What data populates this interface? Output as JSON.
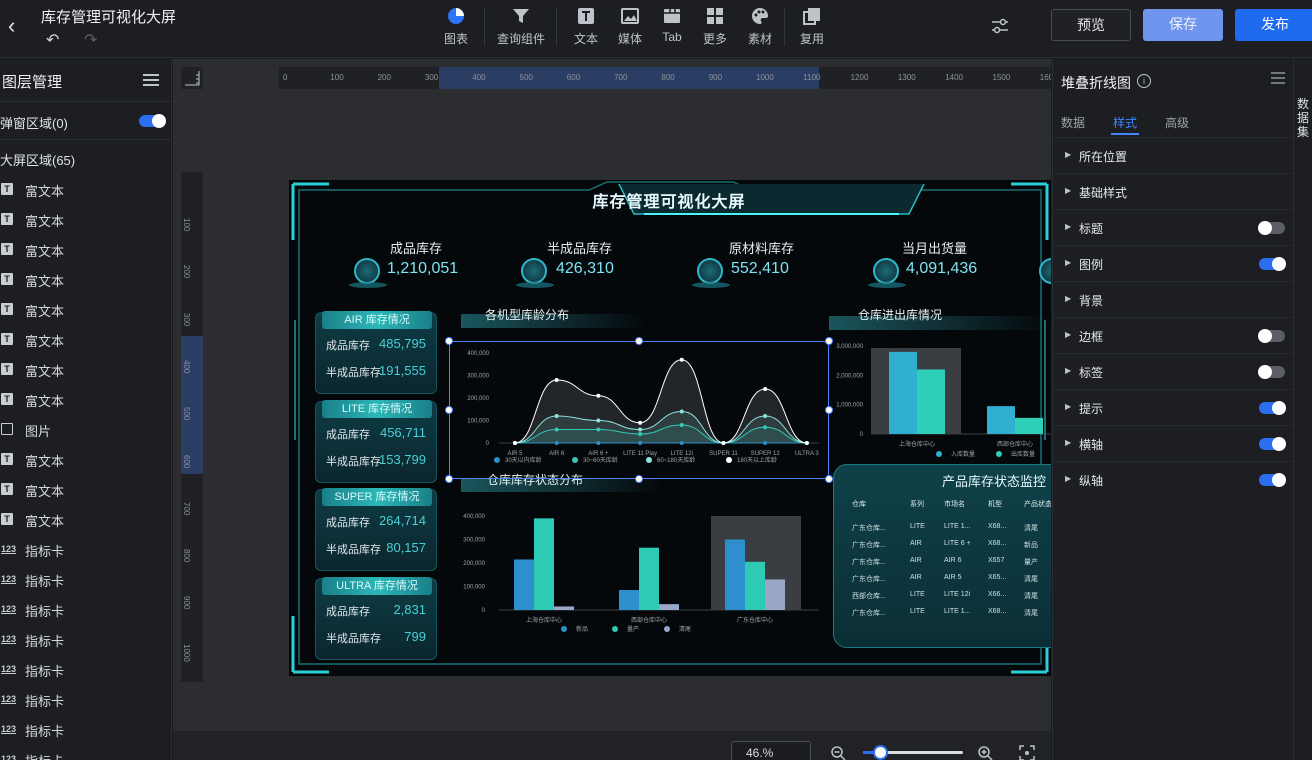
{
  "header": {
    "title": "库存管理可视化大屏",
    "toolbar": [
      {
        "label": "图表",
        "icon": "pie-chart-icon"
      },
      {
        "label": "查询组件",
        "icon": "filter-icon"
      },
      {
        "label": "文本",
        "icon": "text-icon"
      },
      {
        "label": "媒体",
        "icon": "image-icon"
      },
      {
        "label": "Tab",
        "icon": "tab-icon"
      },
      {
        "label": "更多",
        "icon": "grid-icon"
      },
      {
        "label": "素材",
        "icon": "palette-icon"
      },
      {
        "label": "复用",
        "icon": "copy-icon"
      }
    ],
    "preview_label": "预览",
    "save_label": "保存",
    "publish_label": "发布"
  },
  "layers": {
    "title": "图层管理",
    "popup_area": "弹窗区域(0)",
    "popup_toggle": true,
    "screen_area": "大屏区域(65)",
    "items": [
      {
        "type": "T",
        "name": "富文本"
      },
      {
        "type": "T",
        "name": "富文本"
      },
      {
        "type": "T",
        "name": "富文本"
      },
      {
        "type": "T",
        "name": "富文本"
      },
      {
        "type": "T",
        "name": "富文本"
      },
      {
        "type": "T",
        "name": "富文本"
      },
      {
        "type": "T",
        "name": "富文本"
      },
      {
        "type": "T",
        "name": "富文本"
      },
      {
        "type": "img",
        "name": "图片"
      },
      {
        "type": "T",
        "name": "富文本"
      },
      {
        "type": "T",
        "name": "富文本"
      },
      {
        "type": "T",
        "name": "富文本"
      },
      {
        "type": "123",
        "name": "指标卡"
      },
      {
        "type": "123",
        "name": "指标卡"
      },
      {
        "type": "123",
        "name": "指标卡"
      },
      {
        "type": "123",
        "name": "指标卡"
      },
      {
        "type": "123",
        "name": "指标卡"
      },
      {
        "type": "123",
        "name": "指标卡"
      },
      {
        "type": "123",
        "name": "指标卡"
      },
      {
        "type": "123",
        "name": "指标卡"
      }
    ]
  },
  "ruler": {
    "top": [
      "0",
      "100",
      "200",
      "300",
      "400",
      "500",
      "600",
      "700",
      "800",
      "900",
      "1000",
      "1100",
      "1200",
      "1300",
      "1400",
      "1500",
      "1600"
    ],
    "left": [
      "100",
      "200",
      "300",
      "400",
      "500",
      "600",
      "700",
      "800",
      "900",
      "1000"
    ]
  },
  "zoom": "46.%",
  "dashboard": {
    "title": "库存管理可视化大屏",
    "kpis": [
      {
        "label": "成品库存",
        "value": "1,210,051"
      },
      {
        "label": "半成品库存",
        "value": "426,310"
      },
      {
        "label": "原材料库存",
        "value": "552,410"
      },
      {
        "label": "当月出货量",
        "value": "4,091,436"
      }
    ],
    "cards": [
      {
        "title": "AIR 库存情况",
        "rows": [
          {
            "label": "成品库存",
            "value": "485,795"
          },
          {
            "label": "半成品库存",
            "value": "191,555"
          }
        ]
      },
      {
        "title": "LITE 库存情况",
        "rows": [
          {
            "label": "成品库存",
            "value": "456,711"
          },
          {
            "label": "半成品库存",
            "value": "153,799"
          }
        ]
      },
      {
        "title": "SUPER 库存情况",
        "rows": [
          {
            "label": "成品库存",
            "value": "264,714"
          },
          {
            "label": "半成品库存",
            "value": "80,157"
          }
        ]
      },
      {
        "title": "ULTRA 库存情况",
        "rows": [
          {
            "label": "成品库存",
            "value": "2,831"
          },
          {
            "label": "半成品库存",
            "value": "799"
          }
        ]
      }
    ],
    "section_titles": {
      "age": "各机型库龄分布",
      "warehouse_io": "仓库进出库情况",
      "status": "仓库库存状态分布",
      "monitor": "产品库存状态监控"
    },
    "table": {
      "headers": [
        "仓库",
        "系列",
        "市场名",
        "机型",
        "产品状态"
      ],
      "rows": [
        [
          "广东仓库...",
          "LITE",
          "LITE 1...",
          "X68...",
          "清尾"
        ],
        [
          "广东仓库...",
          "AIR",
          "LITE 6 +",
          "X68...",
          "新品"
        ],
        [
          "广东仓库...",
          "AIR",
          "AIR 6",
          "X657",
          "量产"
        ],
        [
          "广东仓库...",
          "AIR",
          "AIR 5",
          "X65...",
          "清尾"
        ],
        [
          "西部仓库...",
          "LITE",
          "LITE 12i",
          "X66...",
          "清尾"
        ],
        [
          "广东仓库...",
          "LITE",
          "LITE 1...",
          "X68...",
          "清尾"
        ]
      ]
    }
  },
  "chart_data": [
    {
      "type": "area",
      "title": "各机型库龄分布",
      "categories": [
        "AIR 5",
        "AIR 6",
        "AIR 6 +",
        "LITE 11 Play",
        "LITE 12i",
        "SUPER 11",
        "SUPER 12",
        "ULTRA 3"
      ],
      "yticks": [
        "0",
        "100,000",
        "200,000",
        "300,000",
        "400,000"
      ],
      "ylim": [
        0,
        400000
      ],
      "stacked": true,
      "series": [
        {
          "name": "30天以内库龄",
          "color": "#2f8ecb",
          "values": [
            0,
            0,
            0,
            0,
            0,
            0,
            0,
            0
          ]
        },
        {
          "name": "30~60天库龄",
          "color": "#35c8b6",
          "values": [
            0,
            60000,
            60000,
            40000,
            80000,
            0,
            70000,
            0
          ]
        },
        {
          "name": "60~180天库龄",
          "color": "#8de3e0",
          "values": [
            0,
            60000,
            40000,
            20000,
            60000,
            0,
            50000,
            0
          ]
        },
        {
          "name": "180天以上库龄",
          "color": "#ffffff",
          "values": [
            0,
            160000,
            110000,
            30000,
            230000,
            0,
            120000,
            0
          ]
        }
      ]
    },
    {
      "type": "bar",
      "title": "仓库进出库情况",
      "categories": [
        "上海仓库中心",
        "西部仓库中心"
      ],
      "yticks": [
        "0",
        "1,000,000",
        "2,000,000",
        "3,000,000"
      ],
      "ylim": [
        0,
        3000000
      ],
      "series": [
        {
          "name": "入库数量",
          "color": "#2fb0d0",
          "values": [
            2800000,
            950000
          ]
        },
        {
          "name": "出库数量",
          "color": "#2fcfb7",
          "values": [
            2200000,
            550000
          ]
        }
      ]
    },
    {
      "type": "bar",
      "title": "仓库库存状态分布",
      "categories": [
        "上海仓库中心",
        "西部仓库中心",
        "广东仓库中心"
      ],
      "yticks": [
        "0",
        "100,000",
        "200,000",
        "300,000",
        "400,000"
      ],
      "ylim": [
        0,
        400000
      ],
      "series": [
        {
          "name": "新品",
          "color": "#2e8fcf",
          "values": [
            215000,
            85000,
            300000
          ]
        },
        {
          "name": "量产",
          "color": "#2dcbb3",
          "values": [
            390000,
            265000,
            205000
          ]
        },
        {
          "name": "清尾",
          "color": "#9aa6c8",
          "values": [
            15000,
            25000,
            130000
          ]
        }
      ]
    }
  ],
  "props": {
    "title": "堆叠折线图",
    "tabs": [
      "数据",
      "样式",
      "高级"
    ],
    "active_tab": "样式",
    "rows": [
      {
        "label": "所在位置",
        "toggle": null
      },
      {
        "label": "基础样式",
        "toggle": null
      },
      {
        "label": "标题",
        "toggle": false
      },
      {
        "label": "图例",
        "toggle": true
      },
      {
        "label": "背景",
        "toggle": null
      },
      {
        "label": "边框",
        "toggle": false
      },
      {
        "label": "标签",
        "toggle": false
      },
      {
        "label": "提示",
        "toggle": true
      },
      {
        "label": "横轴",
        "toggle": true
      },
      {
        "label": "纵轴",
        "toggle": true
      }
    ]
  },
  "sidetab": "数据集"
}
